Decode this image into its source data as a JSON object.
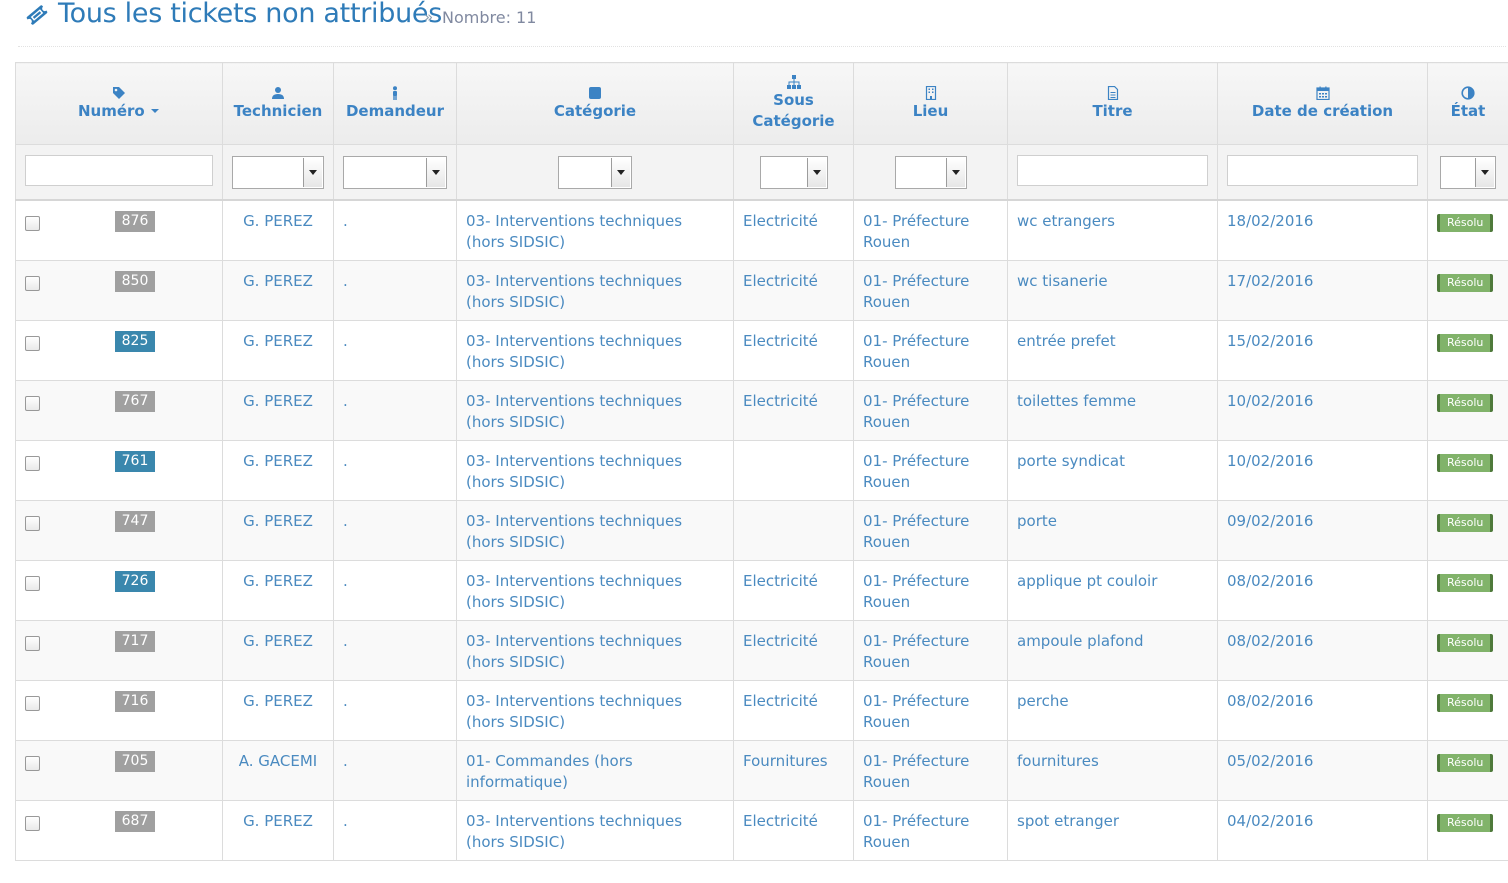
{
  "header": {
    "title": "Tous les tickets non attribués",
    "separator": "»",
    "count_label": "Nombre: 11"
  },
  "columns": [
    {
      "key": "numero",
      "label": "Numéro",
      "icon": "tag-icon",
      "sort": "desc"
    },
    {
      "key": "technicien",
      "label": "Technicien",
      "icon": "user-icon"
    },
    {
      "key": "demandeur",
      "label": "Demandeur",
      "icon": "male-icon"
    },
    {
      "key": "categorie",
      "label": "Catégorie",
      "icon": "square-icon"
    },
    {
      "key": "sous_categorie",
      "label_line1": "Sous",
      "label_line2": "Catégorie",
      "icon": "sitemap-icon"
    },
    {
      "key": "lieu",
      "label": "Lieu",
      "icon": "building-icon"
    },
    {
      "key": "titre",
      "label": "Titre",
      "icon": "file-text-icon"
    },
    {
      "key": "date",
      "label": "Date de création",
      "icon": "calendar-icon"
    },
    {
      "key": "etat",
      "label": "État",
      "icon": "adjust-icon"
    }
  ],
  "rows": [
    {
      "numero": "876",
      "highlight": false,
      "technicien": "G. PEREZ",
      "demandeur": ".",
      "categorie": "03- Interventions techniques (hors SIDSIC)",
      "sous_categorie": "Electricité",
      "lieu": "01- Préfecture Rouen",
      "titre": "wc etrangers",
      "date": "18/02/2016",
      "etat": "Résolu"
    },
    {
      "numero": "850",
      "highlight": false,
      "technicien": "G. PEREZ",
      "demandeur": ".",
      "categorie": "03- Interventions techniques (hors SIDSIC)",
      "sous_categorie": "Electricité",
      "lieu": "01- Préfecture Rouen",
      "titre": "wc tisanerie",
      "date": "17/02/2016",
      "etat": "Résolu"
    },
    {
      "numero": "825",
      "highlight": true,
      "technicien": "G. PEREZ",
      "demandeur": ".",
      "categorie": "03- Interventions techniques (hors SIDSIC)",
      "sous_categorie": "Electricité",
      "lieu": "01- Préfecture Rouen",
      "titre": "entrée prefet",
      "date": "15/02/2016",
      "etat": "Résolu"
    },
    {
      "numero": "767",
      "highlight": false,
      "technicien": "G. PEREZ",
      "demandeur": ".",
      "categorie": "03- Interventions techniques (hors SIDSIC)",
      "sous_categorie": "Electricité",
      "lieu": "01- Préfecture Rouen",
      "titre": "toilettes femme",
      "date": "10/02/2016",
      "etat": "Résolu"
    },
    {
      "numero": "761",
      "highlight": true,
      "technicien": "G. PEREZ",
      "demandeur": ".",
      "categorie": "03- Interventions techniques (hors SIDSIC)",
      "sous_categorie": "",
      "lieu": "01- Préfecture Rouen",
      "titre": "porte syndicat",
      "date": "10/02/2016",
      "etat": "Résolu"
    },
    {
      "numero": "747",
      "highlight": false,
      "technicien": "G. PEREZ",
      "demandeur": ".",
      "categorie": "03- Interventions techniques (hors SIDSIC)",
      "sous_categorie": "",
      "lieu": "01- Préfecture Rouen",
      "titre": "porte",
      "date": "09/02/2016",
      "etat": "Résolu"
    },
    {
      "numero": "726",
      "highlight": true,
      "technicien": "G. PEREZ",
      "demandeur": ".",
      "categorie": "03- Interventions techniques (hors SIDSIC)",
      "sous_categorie": "Electricité",
      "lieu": "01- Préfecture Rouen",
      "titre": "applique pt couloir",
      "date": "08/02/2016",
      "etat": "Résolu"
    },
    {
      "numero": "717",
      "highlight": false,
      "technicien": "G. PEREZ",
      "demandeur": ".",
      "categorie": "03- Interventions techniques (hors SIDSIC)",
      "sous_categorie": "Electricité",
      "lieu": "01- Préfecture Rouen",
      "titre": "ampoule plafond",
      "date": "08/02/2016",
      "etat": "Résolu"
    },
    {
      "numero": "716",
      "highlight": false,
      "technicien": "G. PEREZ",
      "demandeur": ".",
      "categorie": "03- Interventions techniques (hors SIDSIC)",
      "sous_categorie": "Electricité",
      "lieu": "01- Préfecture Rouen",
      "titre": "perche",
      "date": "08/02/2016",
      "etat": "Résolu"
    },
    {
      "numero": "705",
      "highlight": false,
      "technicien": "A. GACEMI",
      "demandeur": ".",
      "categorie": "01- Commandes (hors informatique)",
      "sous_categorie": "Fournitures",
      "lieu": "01- Préfecture Rouen",
      "titre": "fournitures",
      "date": "05/02/2016",
      "etat": "Résolu"
    },
    {
      "numero": "687",
      "highlight": false,
      "technicien": "G. PEREZ",
      "demandeur": ".",
      "categorie": "03- Interventions techniques (hors SIDSIC)",
      "sous_categorie": "Electricité",
      "lieu": "01- Préfecture Rouen",
      "titre": "spot etranger",
      "date": "04/02/2016",
      "etat": "Résolu"
    }
  ],
  "colors": {
    "title": "#2e7bb8",
    "link": "#4a8ac0",
    "badge_gray": "#a0a0a0",
    "badge_blue": "#3a87ad",
    "status_green": "#81b36a"
  }
}
